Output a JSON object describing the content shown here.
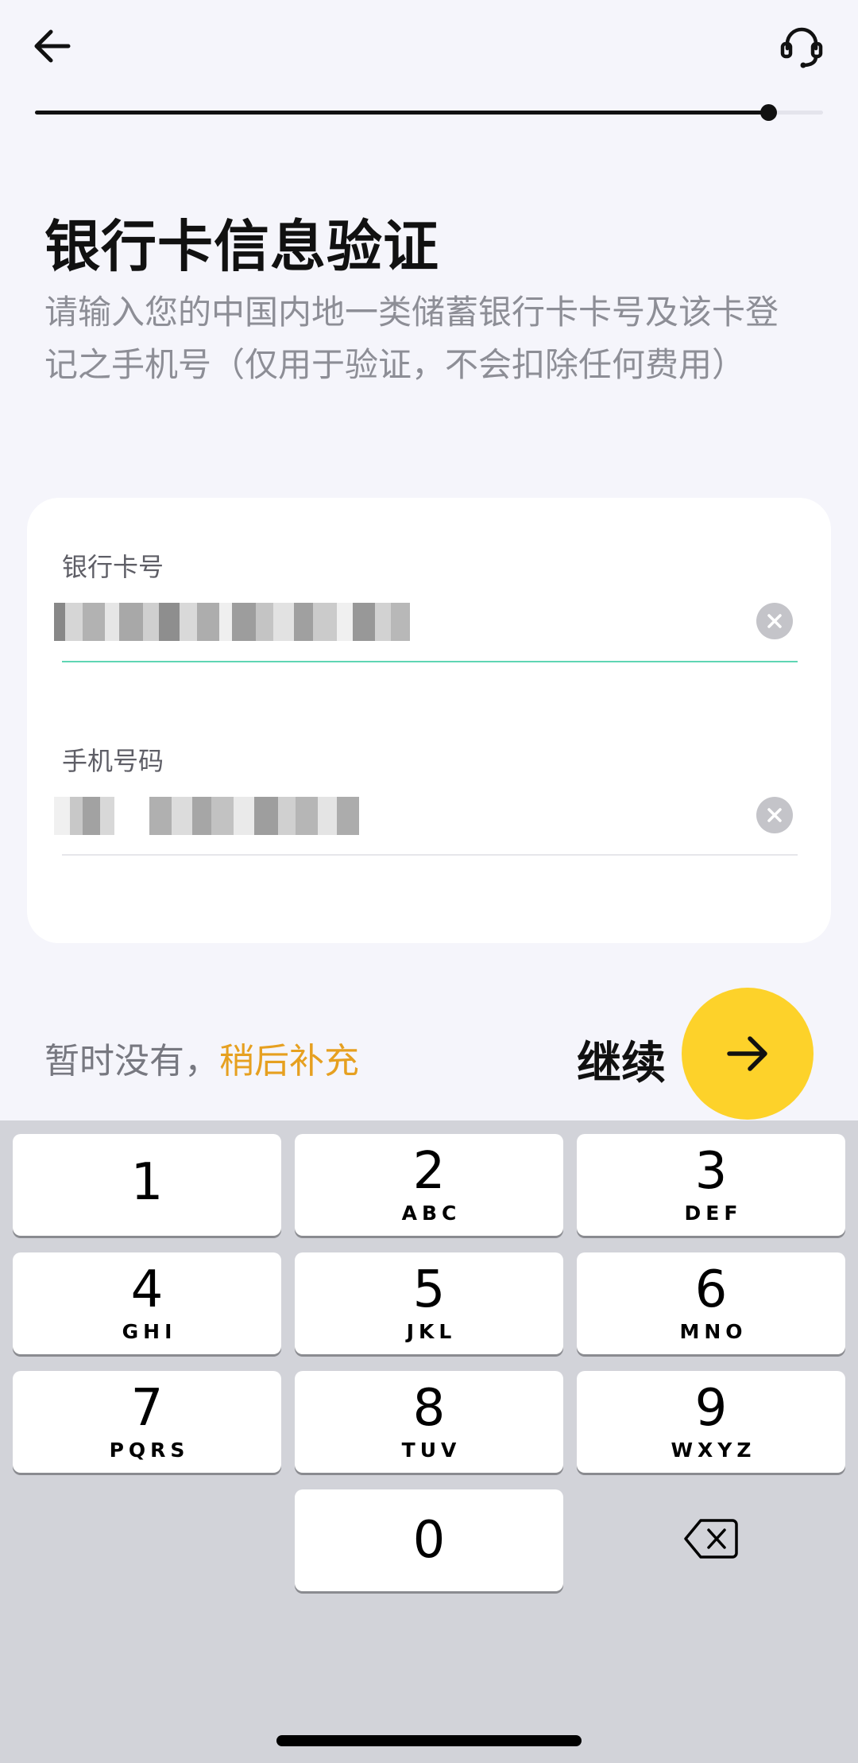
{
  "header": {
    "back_icon": "arrow-left-icon",
    "support_icon": "headset-icon",
    "progress": 0.93
  },
  "title": "银行卡信息验证",
  "subtitle": "请输入您的中国内地一类储蓄银行卡卡号及该卡登记之手机号（仅用于验证，不会扣除任何费用）",
  "form": {
    "card_number": {
      "label": "银行卡号",
      "value_masked": true,
      "focused": true
    },
    "phone_number": {
      "label": "手机号码",
      "value_masked": true,
      "focused": false
    }
  },
  "footer": {
    "later_prefix": "暂时没有，",
    "later_link": "稍后补充",
    "continue_label": "继续",
    "continue_icon": "arrow-right-icon"
  },
  "keypad": {
    "keys": [
      {
        "digit": "1",
        "letters": ""
      },
      {
        "digit": "2",
        "letters": "ABC"
      },
      {
        "digit": "3",
        "letters": "DEF"
      },
      {
        "digit": "4",
        "letters": "GHI"
      },
      {
        "digit": "5",
        "letters": "JKL"
      },
      {
        "digit": "6",
        "letters": "MNO"
      },
      {
        "digit": "7",
        "letters": "PQRS"
      },
      {
        "digit": "8",
        "letters": "TUV"
      },
      {
        "digit": "9",
        "letters": "WXYZ"
      },
      {
        "digit": "0",
        "letters": ""
      }
    ],
    "delete_icon": "backspace-icon"
  },
  "colors": {
    "accent_yellow": "#fdd22a",
    "link_orange": "#e6a020",
    "focus_green": "#5fd6b4",
    "background": "#f5f5fb"
  }
}
